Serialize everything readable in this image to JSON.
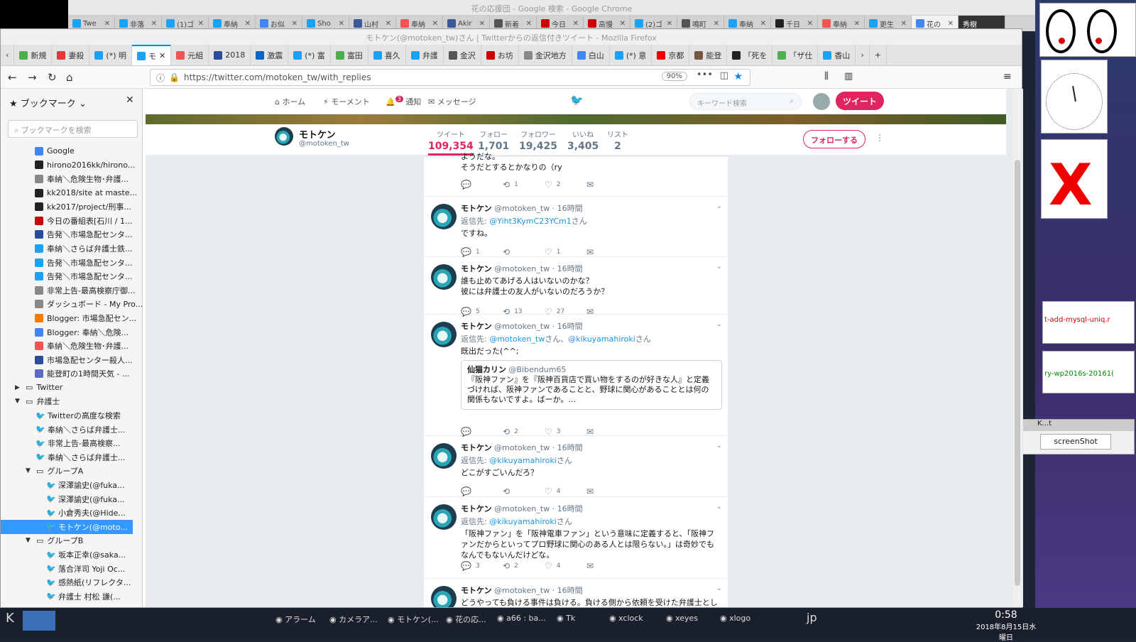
{
  "chrome": {
    "title": "花の応援団 - Google 検索 - Google Chrome",
    "tabs": [
      "Twe",
      "非落",
      "(1)ゴ",
      "奉納",
      "お似",
      "Sho",
      "山村",
      "奉納",
      "Akir",
      "新着",
      "今日",
      "高慢",
      "(2)ゴ",
      "鳴町",
      "奉納",
      "千日",
      "奉納",
      "更生",
      "花の"
    ],
    "user": "秀樹"
  },
  "firefox": {
    "title": "モトケン(@motoken_tw)さん | Twitterからの返信付きツイート - Mozilla Firefox",
    "tabs": [
      "新規",
      "妻殺",
      "(*) 明",
      "モ",
      "元組",
      "2018",
      "激震",
      "(*) 富",
      "富田",
      "喜久",
      "弁護",
      "金沢",
      "お坊",
      "金沢地方",
      "白山",
      "(*) 意",
      "京都",
      "能登",
      "「死を",
      "「ザ仕",
      "香山"
    ],
    "url": "https://twitter.com/motoken_tw/with_replies",
    "zoom": "90%"
  },
  "sidebar": {
    "header": "ブックマーク",
    "search_placeholder": "ブックマークを検索",
    "items": [
      "Google",
      "hirono2016kk/hirono...",
      "奉納＼危険生物･弁護...",
      "kk2018/site at maste...",
      "kk2017/project/刑事...",
      "今日の番組表[石川 / 1...",
      "告発＼市場急配センタ...",
      "奉納＼さらば弁護士鉄...",
      "告発＼市場急配センタ...",
      "告発＼市場急配センタ...",
      "非常上告-最高検察庁御...",
      "ダッシュボード - My Pro...",
      "Blogger: 市場急配セン...",
      "Blogger: 奉納＼危険...",
      "奉納＼危険生物･弁護...",
      "市場急配センター殺人...",
      "能登町の1時間天気 - ...",
      "Twitter",
      "弁護士",
      "Twitterの高度な検索",
      "奉納＼さらば弁護士...",
      "非常上告-最高検察...",
      "奉納＼さらば弁護士...",
      "グループA",
      "深澤諭史(@fuka...",
      "深澤諭史(@fuka...",
      "小倉秀夫(@Hide...",
      "モトケン(@moto...",
      "グループB",
      "坂本正幸(@saka...",
      "落合洋司 Yoji Oc...",
      "感熱紙(リフレクタ...",
      "弁護士 村松 謙(..."
    ]
  },
  "twitter": {
    "nav": {
      "home": "ホーム",
      "moments": "モーメント",
      "notifications": "通知",
      "notif_count": "3",
      "messages": "メッセージ",
      "search_placeholder": "キーワード検索",
      "tweet_button": "ツイート"
    },
    "profile": {
      "name": "モトケン",
      "handle": "@motoken_tw",
      "follow_button": "フォローする",
      "stats": [
        {
          "label": "ツイート",
          "value": "109,354"
        },
        {
          "label": "フォロー",
          "value": "1,701"
        },
        {
          "label": "フォロワー",
          "value": "19,425"
        },
        {
          "label": "いいね",
          "value": "3,405"
        },
        {
          "label": "リスト",
          "value": "2"
        }
      ]
    },
    "partial": {
      "text": "ようだな。\nそうだとするとかなりの（ry",
      "likes": "2",
      "retweets": "1"
    },
    "tweets": [
      {
        "name": "モトケン",
        "handle": "@motoken_tw",
        "time": "16時間",
        "reply_prefix": "返信先:",
        "reply_to": "@Yiht3KymC23YCm1",
        "reply_suffix": "さん",
        "text": "ですね。",
        "replies": "1",
        "retweets": "",
        "likes": "1"
      },
      {
        "name": "モトケン",
        "handle": "@motoken_tw",
        "time": "16時間",
        "text": "誰も止めてあげる人はいないのかな？\n彼には弁護士の友人がいないのだろうか？",
        "replies": "5",
        "retweets": "13",
        "likes": "27"
      },
      {
        "name": "モトケン",
        "handle": "@motoken_tw",
        "time": "16時間",
        "reply_prefix": "返信先:",
        "reply_to": "@motoken_tw",
        "reply_mid": "さん、",
        "reply_to2": "@kikuyamahiroki",
        "reply_suffix": "さん",
        "text": "既出だった(^^;",
        "quote": {
          "name": "仙猫カリン",
          "handle": "@Bibendum65",
          "text": "『阪神ファン』を『阪神百貨店で買い物をするのが好きな人』と定義づければ、阪神ファンであることと、野球に関心があることとは何の関係もないですよ。ばーか。..."
        },
        "replies": "",
        "retweets": "2",
        "likes": "3"
      },
      {
        "name": "モトケン",
        "handle": "@motoken_tw",
        "time": "16時間",
        "reply_prefix": "返信先:",
        "reply_to": "@kikuyamahiroki",
        "reply_suffix": "さん",
        "text": "どこがすごいんだろ？",
        "replies": "",
        "retweets": "",
        "likes": "4"
      },
      {
        "name": "モトケン",
        "handle": "@motoken_tw",
        "time": "16時間",
        "reply_prefix": "返信先:",
        "reply_to": "@kikuyamahiroki",
        "reply_suffix": "さん",
        "text": "「阪神ファン」を「阪神電車ファン」という意味に定義すると、「阪神ファンだからといってプロ野球に関心のある人とは限らない。」は奇妙でもなんでもないんだけどな。",
        "replies": "3",
        "retweets": "2",
        "likes": "4"
      },
      {
        "name": "モトケン",
        "handle": "@motoken_tw",
        "time": "16時間",
        "text": "どうやっても負ける事件は負ける。負ける側から依頼を受けた弁護士としては"
      }
    ]
  },
  "taskbar": {
    "items": [
      "アラーム",
      "カメラア...",
      "モトケン(...",
      "花の応...",
      "a66 : ba...",
      "Tk",
      "xclock",
      "xeyes",
      "xlogo"
    ],
    "lang": "jp",
    "time": "0:58",
    "date": "2018年8月15日水曜日"
  },
  "desktop": {
    "kt_title": "K...t",
    "kt_button": "screenShot",
    "url_snippet1": "t-add-mysql-uniq.r",
    "url_snippet2": "ry-wp2016s-20161("
  }
}
